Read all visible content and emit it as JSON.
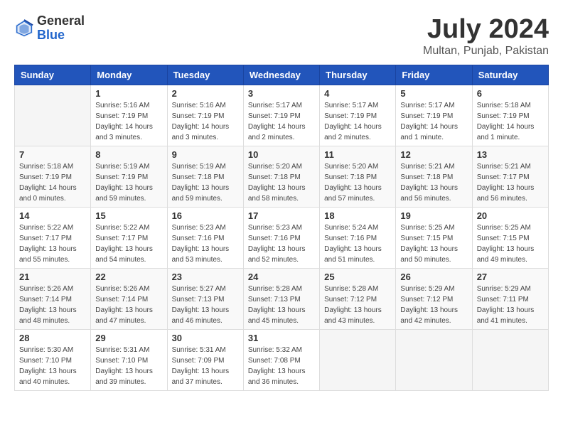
{
  "header": {
    "logo_general": "General",
    "logo_blue": "Blue",
    "month_year": "July 2024",
    "location": "Multan, Punjab, Pakistan"
  },
  "days_of_week": [
    "Sunday",
    "Monday",
    "Tuesday",
    "Wednesday",
    "Thursday",
    "Friday",
    "Saturday"
  ],
  "weeks": [
    [
      {
        "day": "",
        "sunrise": "",
        "sunset": "",
        "daylight": ""
      },
      {
        "day": "1",
        "sunrise": "Sunrise: 5:16 AM",
        "sunset": "Sunset: 7:19 PM",
        "daylight": "Daylight: 14 hours and 3 minutes."
      },
      {
        "day": "2",
        "sunrise": "Sunrise: 5:16 AM",
        "sunset": "Sunset: 7:19 PM",
        "daylight": "Daylight: 14 hours and 3 minutes."
      },
      {
        "day": "3",
        "sunrise": "Sunrise: 5:17 AM",
        "sunset": "Sunset: 7:19 PM",
        "daylight": "Daylight: 14 hours and 2 minutes."
      },
      {
        "day": "4",
        "sunrise": "Sunrise: 5:17 AM",
        "sunset": "Sunset: 7:19 PM",
        "daylight": "Daylight: 14 hours and 2 minutes."
      },
      {
        "day": "5",
        "sunrise": "Sunrise: 5:17 AM",
        "sunset": "Sunset: 7:19 PM",
        "daylight": "Daylight: 14 hours and 1 minute."
      },
      {
        "day": "6",
        "sunrise": "Sunrise: 5:18 AM",
        "sunset": "Sunset: 7:19 PM",
        "daylight": "Daylight: 14 hours and 1 minute."
      }
    ],
    [
      {
        "day": "7",
        "sunrise": "Sunrise: 5:18 AM",
        "sunset": "Sunset: 7:19 PM",
        "daylight": "Daylight: 14 hours and 0 minutes."
      },
      {
        "day": "8",
        "sunrise": "Sunrise: 5:19 AM",
        "sunset": "Sunset: 7:19 PM",
        "daylight": "Daylight: 13 hours and 59 minutes."
      },
      {
        "day": "9",
        "sunrise": "Sunrise: 5:19 AM",
        "sunset": "Sunset: 7:18 PM",
        "daylight": "Daylight: 13 hours and 59 minutes."
      },
      {
        "day": "10",
        "sunrise": "Sunrise: 5:20 AM",
        "sunset": "Sunset: 7:18 PM",
        "daylight": "Daylight: 13 hours and 58 minutes."
      },
      {
        "day": "11",
        "sunrise": "Sunrise: 5:20 AM",
        "sunset": "Sunset: 7:18 PM",
        "daylight": "Daylight: 13 hours and 57 minutes."
      },
      {
        "day": "12",
        "sunrise": "Sunrise: 5:21 AM",
        "sunset": "Sunset: 7:18 PM",
        "daylight": "Daylight: 13 hours and 56 minutes."
      },
      {
        "day": "13",
        "sunrise": "Sunrise: 5:21 AM",
        "sunset": "Sunset: 7:17 PM",
        "daylight": "Daylight: 13 hours and 56 minutes."
      }
    ],
    [
      {
        "day": "14",
        "sunrise": "Sunrise: 5:22 AM",
        "sunset": "Sunset: 7:17 PM",
        "daylight": "Daylight: 13 hours and 55 minutes."
      },
      {
        "day": "15",
        "sunrise": "Sunrise: 5:22 AM",
        "sunset": "Sunset: 7:17 PM",
        "daylight": "Daylight: 13 hours and 54 minutes."
      },
      {
        "day": "16",
        "sunrise": "Sunrise: 5:23 AM",
        "sunset": "Sunset: 7:16 PM",
        "daylight": "Daylight: 13 hours and 53 minutes."
      },
      {
        "day": "17",
        "sunrise": "Sunrise: 5:23 AM",
        "sunset": "Sunset: 7:16 PM",
        "daylight": "Daylight: 13 hours and 52 minutes."
      },
      {
        "day": "18",
        "sunrise": "Sunrise: 5:24 AM",
        "sunset": "Sunset: 7:16 PM",
        "daylight": "Daylight: 13 hours and 51 minutes."
      },
      {
        "day": "19",
        "sunrise": "Sunrise: 5:25 AM",
        "sunset": "Sunset: 7:15 PM",
        "daylight": "Daylight: 13 hours and 50 minutes."
      },
      {
        "day": "20",
        "sunrise": "Sunrise: 5:25 AM",
        "sunset": "Sunset: 7:15 PM",
        "daylight": "Daylight: 13 hours and 49 minutes."
      }
    ],
    [
      {
        "day": "21",
        "sunrise": "Sunrise: 5:26 AM",
        "sunset": "Sunset: 7:14 PM",
        "daylight": "Daylight: 13 hours and 48 minutes."
      },
      {
        "day": "22",
        "sunrise": "Sunrise: 5:26 AM",
        "sunset": "Sunset: 7:14 PM",
        "daylight": "Daylight: 13 hours and 47 minutes."
      },
      {
        "day": "23",
        "sunrise": "Sunrise: 5:27 AM",
        "sunset": "Sunset: 7:13 PM",
        "daylight": "Daylight: 13 hours and 46 minutes."
      },
      {
        "day": "24",
        "sunrise": "Sunrise: 5:28 AM",
        "sunset": "Sunset: 7:13 PM",
        "daylight": "Daylight: 13 hours and 45 minutes."
      },
      {
        "day": "25",
        "sunrise": "Sunrise: 5:28 AM",
        "sunset": "Sunset: 7:12 PM",
        "daylight": "Daylight: 13 hours and 43 minutes."
      },
      {
        "day": "26",
        "sunrise": "Sunrise: 5:29 AM",
        "sunset": "Sunset: 7:12 PM",
        "daylight": "Daylight: 13 hours and 42 minutes."
      },
      {
        "day": "27",
        "sunrise": "Sunrise: 5:29 AM",
        "sunset": "Sunset: 7:11 PM",
        "daylight": "Daylight: 13 hours and 41 minutes."
      }
    ],
    [
      {
        "day": "28",
        "sunrise": "Sunrise: 5:30 AM",
        "sunset": "Sunset: 7:10 PM",
        "daylight": "Daylight: 13 hours and 40 minutes."
      },
      {
        "day": "29",
        "sunrise": "Sunrise: 5:31 AM",
        "sunset": "Sunset: 7:10 PM",
        "daylight": "Daylight: 13 hours and 39 minutes."
      },
      {
        "day": "30",
        "sunrise": "Sunrise: 5:31 AM",
        "sunset": "Sunset: 7:09 PM",
        "daylight": "Daylight: 13 hours and 37 minutes."
      },
      {
        "day": "31",
        "sunrise": "Sunrise: 5:32 AM",
        "sunset": "Sunset: 7:08 PM",
        "daylight": "Daylight: 13 hours and 36 minutes."
      },
      {
        "day": "",
        "sunrise": "",
        "sunset": "",
        "daylight": ""
      },
      {
        "day": "",
        "sunrise": "",
        "sunset": "",
        "daylight": ""
      },
      {
        "day": "",
        "sunrise": "",
        "sunset": "",
        "daylight": ""
      }
    ]
  ]
}
